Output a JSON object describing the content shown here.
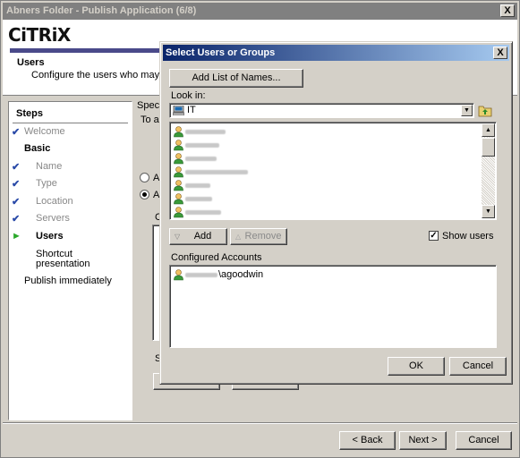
{
  "window": {
    "title": "Abners Folder - Publish Application (6/8)",
    "close_label": "X"
  },
  "header": {
    "logo": "CiTRiX",
    "title": "Users",
    "description": "Configure the users who may acces"
  },
  "steps": {
    "title": "Steps",
    "items": [
      {
        "label": "Welcome",
        "state": "done"
      },
      {
        "label": "Basic",
        "state": "group"
      },
      {
        "label": "Name",
        "state": "done"
      },
      {
        "label": "Type",
        "state": "done"
      },
      {
        "label": "Location",
        "state": "done"
      },
      {
        "label": "Servers",
        "state": "done"
      },
      {
        "label": "Users",
        "state": "current"
      },
      {
        "label": "Shortcut",
        "state": "pending"
      },
      {
        "label": "presentation",
        "state": "pending"
      },
      {
        "label": "Publish immediately",
        "state": "pending"
      }
    ]
  },
  "main": {
    "specify_prefix": "Specif",
    "access_prefix": "To ac",
    "radio_all_1": "All",
    "radio_all_2": "All",
    "c_label": "C",
    "s_label": "S"
  },
  "footer": {
    "back_label": "< Back",
    "next_label": "Next >",
    "cancel_label": "Cancel"
  },
  "dialog": {
    "title": "Select Users or Groups",
    "close_label": "X",
    "add_list_label": "Add List of Names...",
    "look_in_label": "Look in:",
    "look_in_value": "IT",
    "add_label": "Add",
    "remove_label": "Remove",
    "show_users_label": "Show users",
    "show_users_checked": true,
    "configured_label": "Configured Accounts",
    "configured_account": "\\agoodwin",
    "ok_label": "OK",
    "cancel_label": "Cancel"
  },
  "colors": {
    "title_gradient_start": "#0a246a",
    "title_gradient_end": "#a6caf0",
    "check_blue": "#2a4aa8",
    "arrow_green": "#2aa82a"
  }
}
